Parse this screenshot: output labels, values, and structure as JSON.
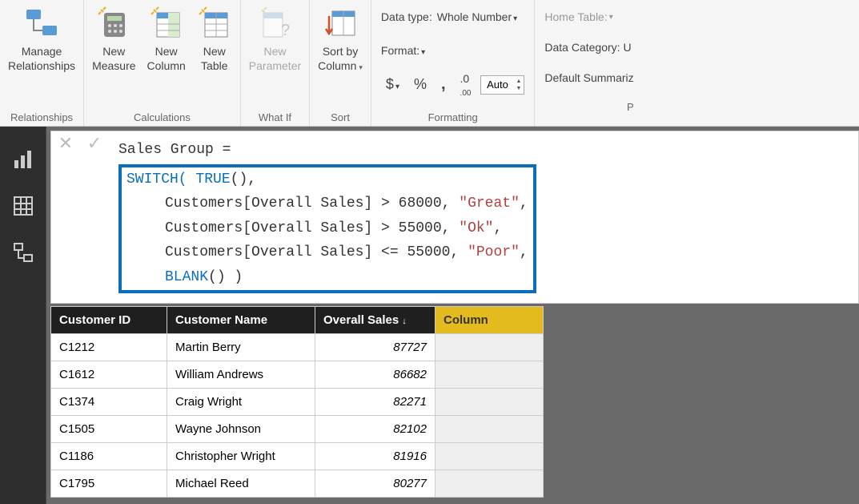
{
  "ribbon": {
    "relationships": {
      "manage": "Manage\nRelationships",
      "label": "Relationships"
    },
    "calculations": {
      "measure": "New\nMeasure",
      "column": "New\nColumn",
      "table": "New\nTable",
      "label": "Calculations"
    },
    "whatif": {
      "param": "New\nParameter",
      "label": "What If"
    },
    "sort": {
      "btn": "Sort by\nColumn",
      "label": "Sort"
    },
    "formatting": {
      "datatype_lbl": "Data type:",
      "datatype_val": "Whole Number",
      "format_lbl": "Format:",
      "decimals_val": "Auto",
      "label": "Formatting"
    },
    "properties": {
      "home": "Home Table:",
      "datacat": "Data Category: U",
      "summ": "Default Summariz",
      "label": "P"
    }
  },
  "formula": {
    "line1": "Sales Group =",
    "switch_kw": "SWITCH(",
    "true_kw": " TRUE",
    "true_paren": "(),",
    "l2a": "Customers[Overall Sales] > 68000, ",
    "l2q": "\"Great\"",
    "l2c": ",",
    "l3a": "Customers[Overall Sales] > 55000, ",
    "l3q": "\"Ok\"",
    "l3c": ",",
    "l4a": "Customers[Overall Sales] <= 55000, ",
    "l4q": "\"Poor\"",
    "l4c": ",",
    "blank_kw": "BLANK",
    "blank_paren": "() )"
  },
  "table": {
    "headers": {
      "id": "Customer ID",
      "name": "Customer Name",
      "sales": "Overall Sales",
      "col": "Column"
    },
    "rows": [
      {
        "id": "C1212",
        "name": "Martin Berry",
        "sales": "87727"
      },
      {
        "id": "C1612",
        "name": "William Andrews",
        "sales": "86682"
      },
      {
        "id": "C1374",
        "name": "Craig Wright",
        "sales": "82271"
      },
      {
        "id": "C1505",
        "name": "Wayne Johnson",
        "sales": "82102"
      },
      {
        "id": "C1186",
        "name": "Christopher Wright",
        "sales": "81916"
      },
      {
        "id": "C1795",
        "name": "Michael Reed",
        "sales": "80277"
      }
    ]
  }
}
